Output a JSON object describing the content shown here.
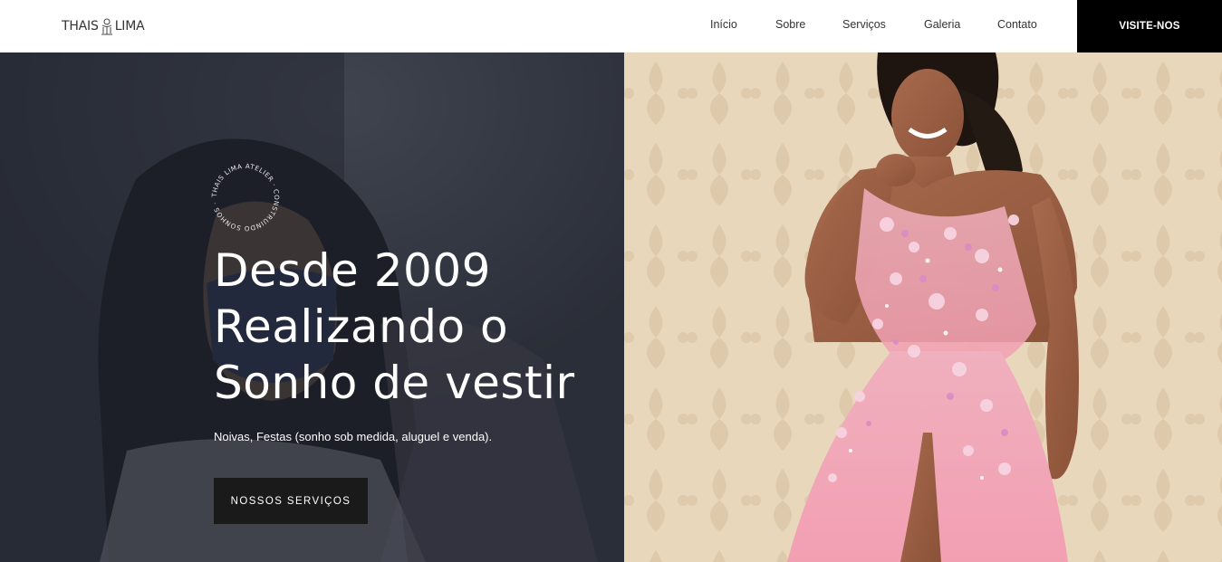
{
  "header": {
    "brand_left": "THAIS",
    "brand_right": "LIMA",
    "nav": [
      "Início",
      "Sobre",
      "Serviços",
      "Galeria",
      "Contato"
    ],
    "cta": "VISITE-NOS"
  },
  "hero": {
    "badge_text": "THAIS LIMA ATELIER · CONSTRUINDO SONHOS ·",
    "title_lines": [
      "Desde 2009",
      "Realizando o",
      "Sonho de vestir"
    ],
    "subtitle": "Noivas, Festas (sonho sob medida, aluguel e venda).",
    "button": "NOSSOS SERVIÇOS"
  },
  "colors": {
    "nav_text": "#333333",
    "cta_bg": "#000000",
    "button_bg": "#1a1a1a",
    "dress_pink": "#f2a7b6",
    "wall": "#e6d4b8"
  }
}
